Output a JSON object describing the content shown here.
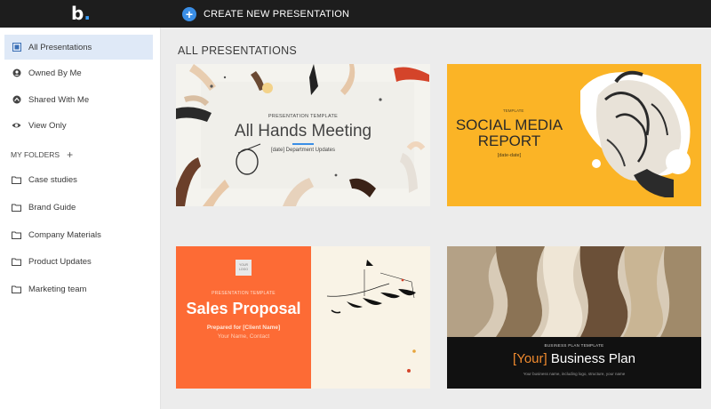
{
  "topbar": {
    "logo": "b",
    "create_label": "CREATE NEW PRESENTATION"
  },
  "sidebar": {
    "items": [
      {
        "label": "All Presentations",
        "icon": "presentation-icon",
        "active": true
      },
      {
        "label": "Owned By Me",
        "icon": "user-icon"
      },
      {
        "label": "Shared With Me",
        "icon": "share-icon"
      },
      {
        "label": "View Only",
        "icon": "eye-icon"
      }
    ],
    "folders_label": "MY FOLDERS",
    "folders": [
      {
        "label": "Case studies",
        "icon": "folder-icon"
      },
      {
        "label": "Brand Guide",
        "icon": "folder-icon"
      },
      {
        "label": "Company Materials",
        "icon": "folder-icon"
      },
      {
        "label": "Product Updates",
        "icon": "folder-icon"
      },
      {
        "label": "Marketing team",
        "icon": "folder-icon"
      }
    ]
  },
  "main": {
    "title": "ALL PRESENTATIONS",
    "cards": [
      {
        "tag": "PRESENTATION TEMPLATE",
        "title": "All Hands Meeting",
        "subtitle": "[date] Department Updates"
      },
      {
        "tag": "TEMPLATE",
        "title_line1": "SOCIAL MEDIA",
        "title_line2": "REPORT",
        "subtitle": "[date-date]"
      },
      {
        "logo_text": "YOUR LOGO",
        "tag": "PRESENTATION TEMPLATE",
        "title": "Sales Proposal",
        "subtitle": "Prepared for [Client Name]",
        "subtitle2": "Your Name, Contact"
      },
      {
        "tag": "BUSINESS PLAN TEMPLATE",
        "title_highlight": "[Your]",
        "title_rest": " Business Plan",
        "subtitle": "Your business name, including logo, structure, your name"
      }
    ]
  },
  "colors": {
    "accent": "#3a8ee6",
    "orange": "#fd6b35",
    "yellow": "#fbb426"
  }
}
